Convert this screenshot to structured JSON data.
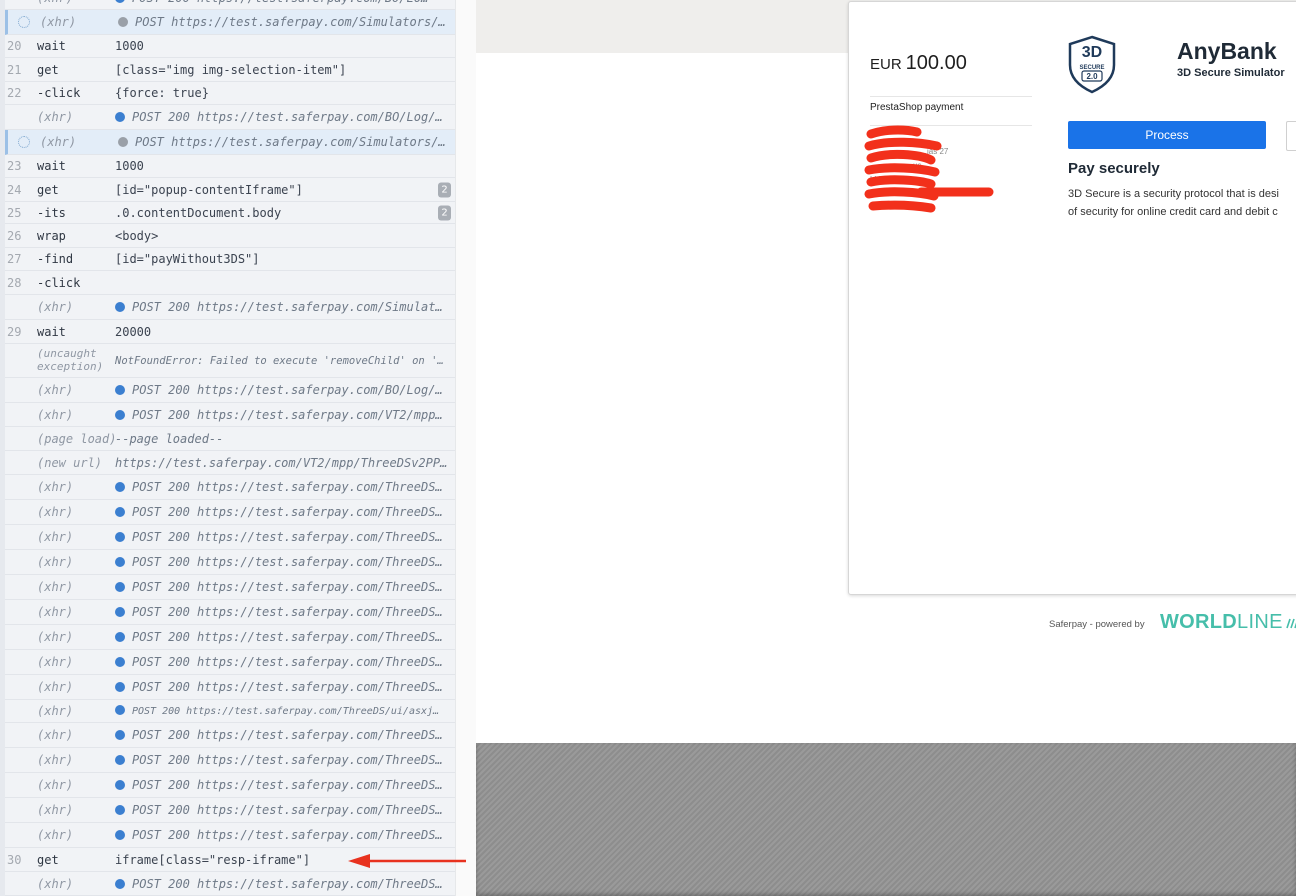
{
  "log": {
    "rows": [
      {
        "num": "",
        "name": "(xhr)",
        "msg": "POST 200 https://test.saferpay.com/BO/Lo…",
        "kind": "xhr",
        "cut": true
      },
      {
        "num": "",
        "name": "(xhr)",
        "msg": "POST https://test.saferpay.com/Simulators/…",
        "kind": "xhr-pending"
      },
      {
        "num": "20",
        "name": "wait",
        "msg": "1000",
        "kind": "cmd"
      },
      {
        "num": "21",
        "name": "get",
        "msg": "[class=\"img img-selection-item\"]",
        "kind": "cmd"
      },
      {
        "num": "22",
        "name": "-click",
        "msg": "{force: true}",
        "kind": "cmd"
      },
      {
        "num": "",
        "name": "(xhr)",
        "msg": "POST 200 https://test.saferpay.com/BO/Log/…",
        "kind": "xhr"
      },
      {
        "num": "",
        "name": "(xhr)",
        "msg": "POST https://test.saferpay.com/Simulators/…",
        "kind": "xhr-pending"
      },
      {
        "num": "23",
        "name": "wait",
        "msg": "1000",
        "kind": "cmd"
      },
      {
        "num": "24",
        "name": "get",
        "msg": "[id=\"popup-contentIframe\"]",
        "kind": "cmd",
        "badge": "2"
      },
      {
        "num": "25",
        "name": "-its",
        "msg": ".0.contentDocument.body",
        "kind": "cmd",
        "badge": "2"
      },
      {
        "num": "26",
        "name": "wrap",
        "msg": "<body>",
        "kind": "cmd"
      },
      {
        "num": "27",
        "name": "-find",
        "msg": "[id=\"payWithout3DS\"]",
        "kind": "cmd"
      },
      {
        "num": "28",
        "name": "-click",
        "msg": "",
        "kind": "cmd"
      },
      {
        "num": "",
        "name": "(xhr)",
        "msg": "POST 200 https://test.saferpay.com/Simulat…",
        "kind": "xhr"
      },
      {
        "num": "29",
        "name": "wait",
        "msg": "20000",
        "kind": "cmd"
      },
      {
        "num": "",
        "name": "(uncaught exception)",
        "msg": "NotFoundError: Failed to execute 'removeChild' on 'N…",
        "kind": "error"
      },
      {
        "num": "",
        "name": "(xhr)",
        "msg": "POST 200 https://test.saferpay.com/BO/Log/…",
        "kind": "xhr"
      },
      {
        "num": "",
        "name": "(xhr)",
        "msg": "POST 200 https://test.saferpay.com/VT2/mpp…",
        "kind": "xhr"
      },
      {
        "num": "",
        "name": "(page load)",
        "msg": "--page loaded--",
        "kind": "event"
      },
      {
        "num": "",
        "name": "(new url)",
        "msg": "https://test.saferpay.com/VT2/mpp/ThreeDSv2PP…",
        "kind": "event"
      },
      {
        "num": "",
        "name": "(xhr)",
        "msg": "POST 200 https://test.saferpay.com/ThreeDS…",
        "kind": "xhr"
      },
      {
        "num": "",
        "name": "(xhr)",
        "msg": "POST 200 https://test.saferpay.com/ThreeDS…",
        "kind": "xhr"
      },
      {
        "num": "",
        "name": "(xhr)",
        "msg": "POST 200 https://test.saferpay.com/ThreeDS…",
        "kind": "xhr"
      },
      {
        "num": "",
        "name": "(xhr)",
        "msg": "POST 200 https://test.saferpay.com/ThreeDS…",
        "kind": "xhr"
      },
      {
        "num": "",
        "name": "(xhr)",
        "msg": "POST 200 https://test.saferpay.com/ThreeDS…",
        "kind": "xhr"
      },
      {
        "num": "",
        "name": "(xhr)",
        "msg": "POST 200 https://test.saferpay.com/ThreeDS…",
        "kind": "xhr"
      },
      {
        "num": "",
        "name": "(xhr)",
        "msg": "POST 200 https://test.saferpay.com/ThreeDS…",
        "kind": "xhr"
      },
      {
        "num": "",
        "name": "(xhr)",
        "msg": "POST 200 https://test.saferpay.com/ThreeDS…",
        "kind": "xhr"
      },
      {
        "num": "",
        "name": "(xhr)",
        "msg": "POST 200 https://test.saferpay.com/ThreeDS…",
        "kind": "xhr"
      },
      {
        "num": "",
        "name": "(xhr)",
        "msg": "POST 200 https://test.saferpay.com/ThreeDS/ui/asxj…",
        "kind": "xhr",
        "small": true
      },
      {
        "num": "",
        "name": "(xhr)",
        "msg": "POST 200 https://test.saferpay.com/ThreeDS…",
        "kind": "xhr"
      },
      {
        "num": "",
        "name": "(xhr)",
        "msg": "POST 200 https://test.saferpay.com/ThreeDS…",
        "kind": "xhr"
      },
      {
        "num": "",
        "name": "(xhr)",
        "msg": "POST 200 https://test.saferpay.com/ThreeDS…",
        "kind": "xhr"
      },
      {
        "num": "",
        "name": "(xhr)",
        "msg": "POST 200 https://test.saferpay.com/ThreeDS…",
        "kind": "xhr"
      },
      {
        "num": "",
        "name": "(xhr)",
        "msg": "POST 200 https://test.saferpay.com/ThreeDS…",
        "kind": "xhr"
      },
      {
        "num": "30",
        "name": "get",
        "msg": "iframe[class=\"resp-iframe\"]",
        "kind": "cmd"
      },
      {
        "num": "",
        "name": "(xhr)",
        "msg": "POST 200 https://test.saferpay.com/ThreeDS…",
        "kind": "xhr"
      }
    ]
  },
  "app": {
    "amount_currency": "EUR",
    "amount_value": "100.00",
    "merchant": "PrestaShop payment",
    "address_line1": "…ias 27",
    "address_line2": "…us",
    "address_line3": "Lithua…",
    "bank_logo": "3D SECURE 2.0",
    "bank_logo_top": "3D",
    "bank_logo_mid": "SECURE",
    "bank_logo_bot": "2.0",
    "bank_name": "AnyBank",
    "bank_subtitle": "3D Secure Simulator",
    "process_label": "Process",
    "pay_title": "Pay securely",
    "pay_desc_1": "3D Secure is a security protocol that is desi",
    "pay_desc_2": "of security for online credit card and debit c",
    "powered_by": "Saferpay - powered by",
    "brand_bold": "WORLD",
    "brand_light": "LINE",
    "brand_color": "#46beaa",
    "accent_color": "#1a73e8"
  }
}
